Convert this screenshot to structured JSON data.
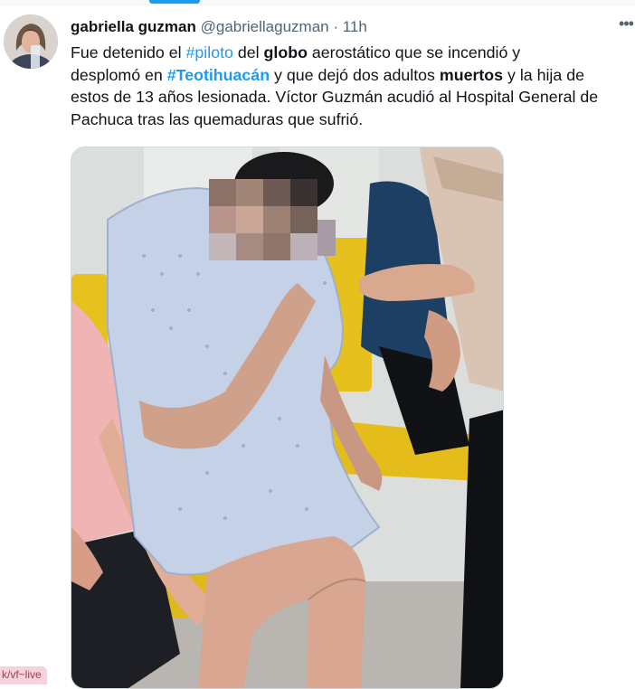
{
  "tweet": {
    "author_name": "gabriella guzman",
    "author_handle": "@gabriellaguzman",
    "separator": " · ",
    "time": "11h",
    "more_icon": "more-horizontal-icon",
    "lines": [
      [
        {
          "t": "Fue detenido  el ",
          "s": "plain"
        },
        {
          "t": "#piloto",
          "s": "hashtag"
        },
        {
          "t": " del ",
          "s": "plain"
        },
        {
          "t": "globo",
          "s": "bold"
        },
        {
          "t": " aerostático que se incendió y",
          "s": "plain"
        }
      ],
      [
        {
          "t": "desplomó en ",
          "s": "plain"
        },
        {
          "t": "#Teotihuacán",
          "s": "hashtag-bold"
        },
        {
          "t": " y que dejó dos adultos ",
          "s": "plain"
        },
        {
          "t": "muertos",
          "s": "bold"
        },
        {
          "t": " y la hija de",
          "s": "plain"
        }
      ],
      [
        {
          "t": "estos de 13 años lesionada. Víctor Guzmán acudió al Hospital General de",
          "s": "plain"
        }
      ],
      [
        {
          "t": "Pachuca tras las quemaduras que sufrió.",
          "s": "plain"
        }
      ]
    ]
  },
  "watermark": "k/vf~live",
  "colors": {
    "hashtag": "#1d9bf0",
    "text": "#0f1419",
    "muted": "#536471",
    "accent": "#1d9bf0"
  }
}
